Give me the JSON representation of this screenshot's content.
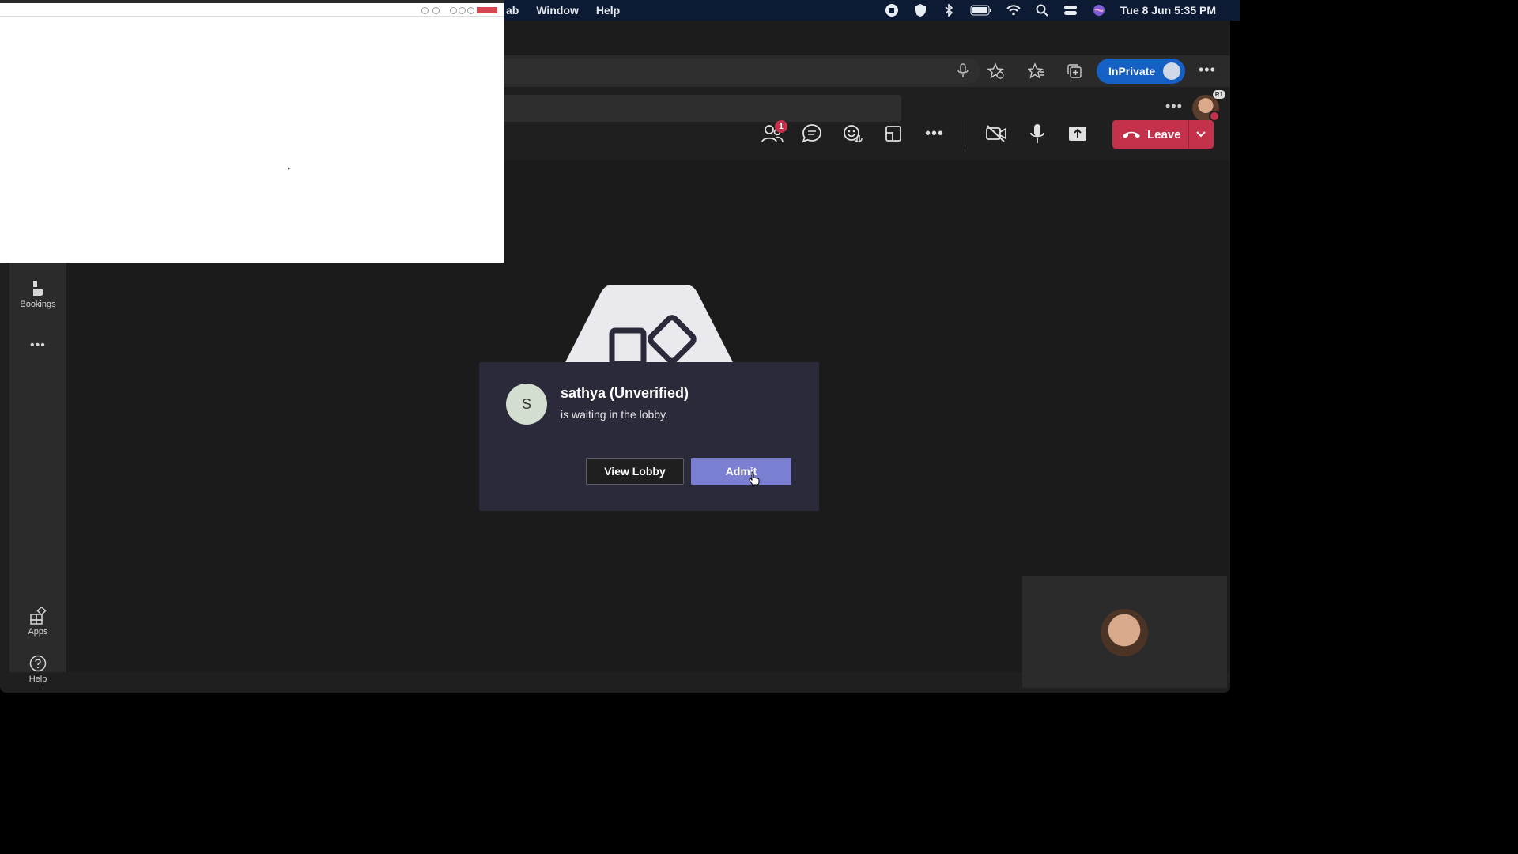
{
  "menubar": {
    "menus": [
      "ab",
      "Window",
      "Help"
    ],
    "clock": "Tue 8 Jun  5:35 PM"
  },
  "browser": {
    "inprivate_label": "InPrivate"
  },
  "teams": {
    "profile_badge": "R1",
    "toolbar": {
      "participants_badge": "1",
      "leave_label": "Leave"
    },
    "rail": {
      "bookings_label": "Bookings",
      "apps_label": "Apps",
      "help_label": "Help"
    },
    "lobby": {
      "avatar_initial": "S",
      "name": "sathya (Unverified)",
      "message": "is waiting in the lobby.",
      "view_lobby_label": "View Lobby",
      "admit_label": "Admit"
    }
  },
  "colors": {
    "leave_red": "#c4314b",
    "admit_purple": "#7b7fd1",
    "inprivate_blue": "#1560c4",
    "menubar": "#0d1a33"
  }
}
